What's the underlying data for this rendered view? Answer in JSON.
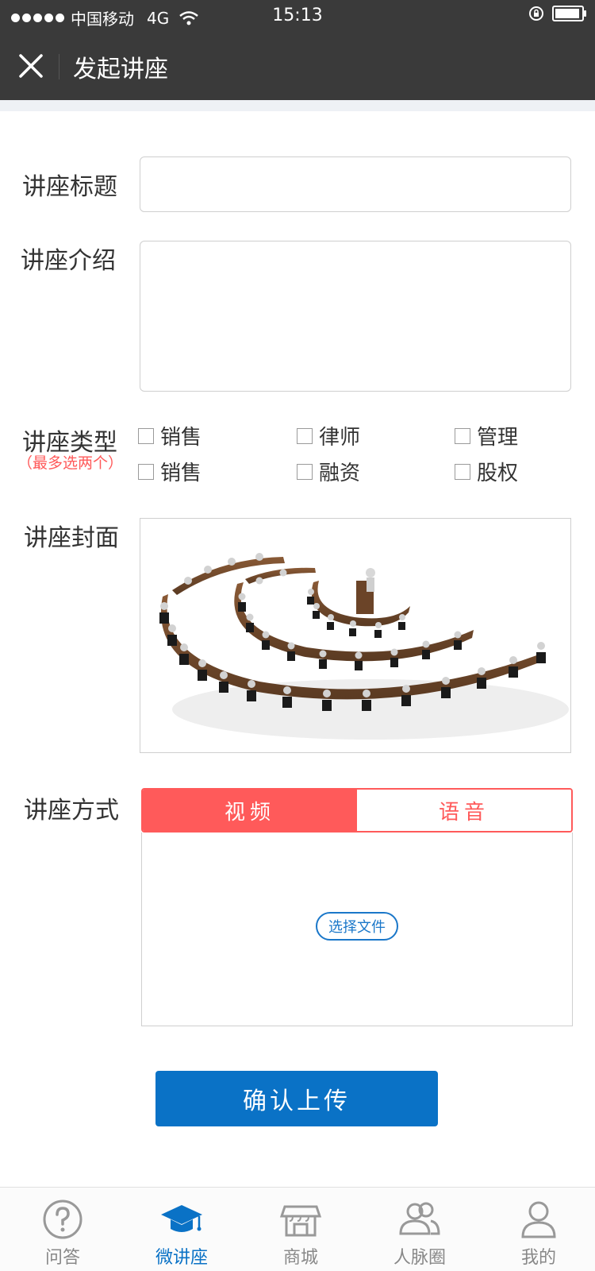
{
  "status_bar": {
    "carrier": "中国移动",
    "network": "4G",
    "time": "15:13"
  },
  "nav": {
    "title": "发起讲座",
    "close_icon": "close-icon"
  },
  "form": {
    "title_label": "讲座标题",
    "title_value": "",
    "intro_label": "讲座介绍",
    "intro_value": "",
    "type_label": "讲座类型",
    "type_hint": "（最多选两个）",
    "type_options": [
      "销售",
      "律师",
      "管理",
      "销售",
      "融资",
      "股权"
    ],
    "cover_label": "讲座封面",
    "method_label": "讲座方式",
    "method_tabs": [
      "视频",
      "语音"
    ],
    "method_active": "视频",
    "choose_file": "选择文件",
    "submit": "确认上传"
  },
  "tabbar": {
    "items": [
      {
        "label": "问答",
        "icon": "question-icon",
        "active": false
      },
      {
        "label": "微讲座",
        "icon": "graduation-cap-icon",
        "active": true
      },
      {
        "label": "商城",
        "icon": "store-icon",
        "active": false
      },
      {
        "label": "人脉圈",
        "icon": "people-icon",
        "active": false
      },
      {
        "label": "我的",
        "icon": "user-icon",
        "active": false
      }
    ]
  },
  "colors": {
    "header_bg": "#3a3a3a",
    "accent_red": "#ff5a5a",
    "primary_blue": "#0a72c6"
  }
}
